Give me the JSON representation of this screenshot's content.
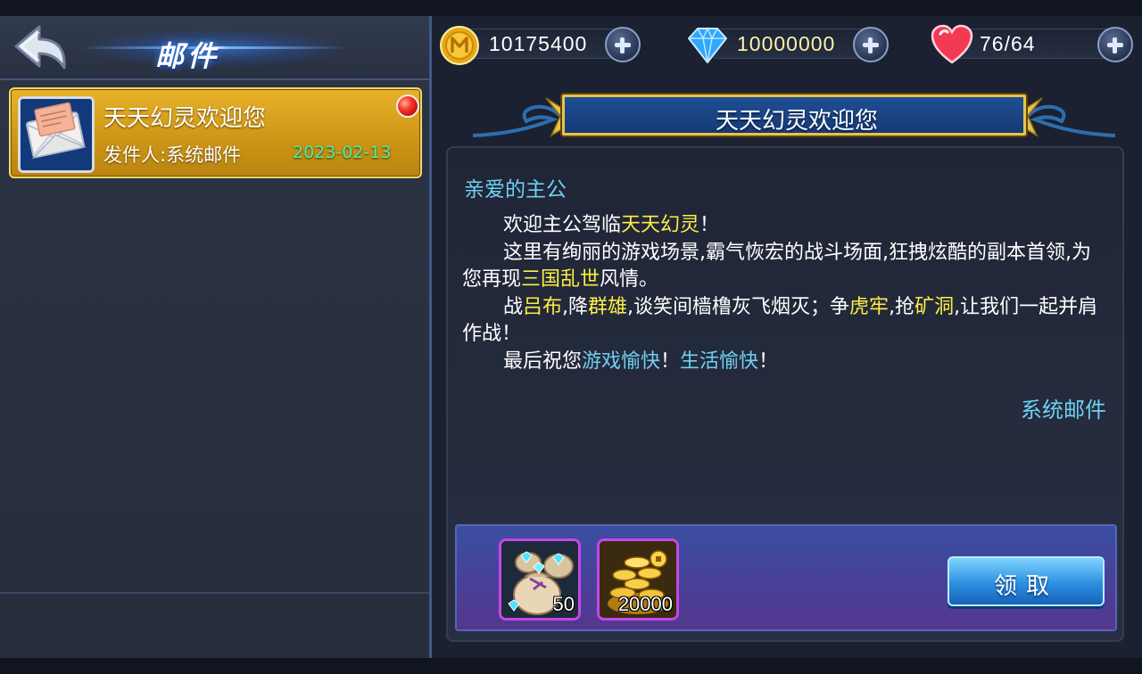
{
  "header": {
    "title": "邮件"
  },
  "resources": {
    "gold": {
      "value": "10175400",
      "icon": "gold-coin-icon"
    },
    "diamond": {
      "value": "10000000",
      "icon": "diamond-icon"
    },
    "stamina": {
      "value": "76/64",
      "icon": "heart-icon"
    }
  },
  "mail_list": [
    {
      "subject": "天天幻灵欢迎您",
      "sender": "发件人:系统邮件",
      "date": "2023-02-13",
      "unread": true,
      "selected": true
    }
  ],
  "mail_detail": {
    "title": "天天幻灵欢迎您",
    "greeting": "亲爱的主公",
    "p1_a": "欢迎主公驾临",
    "p1_hl": "天天幻灵",
    "p1_b": "！",
    "p2_a": "这里有绚丽的游戏场景,霸气恢宏的战斗场面,狂拽炫酷的副本首领,为您再现",
    "p2_hl": "三国乱世",
    "p2_b": "风情。",
    "p3_a": "战",
    "p3_hl1": "吕布",
    "p3_b": ",降",
    "p3_hl2": "群雄",
    "p3_c": ",谈笑间樯橹灰飞烟灭；争",
    "p3_hl3": "虎牢",
    "p3_d": ",抢",
    "p3_hl4": "矿洞",
    "p3_e": ",让我们一起并肩作战！",
    "p4_a": "最后祝您",
    "p4_hl1": "游戏愉快",
    "p4_b": "！",
    "p4_hl2": "生活愉快",
    "p4_c": "！",
    "signature": "系统邮件"
  },
  "rewards": [
    {
      "icon": "diamond-bag-icon",
      "quantity": "50"
    },
    {
      "icon": "gold-coin-pile-icon",
      "quantity": "20000"
    }
  ],
  "claim_button": {
    "label": "领取"
  },
  "colors": {
    "highlight_yellow": "#ffee44",
    "highlight_blue": "#6fd0f2",
    "selected_item": "#d9a21e",
    "claim_button": "#2c8fe0",
    "reward_frame": "#c447e8"
  }
}
